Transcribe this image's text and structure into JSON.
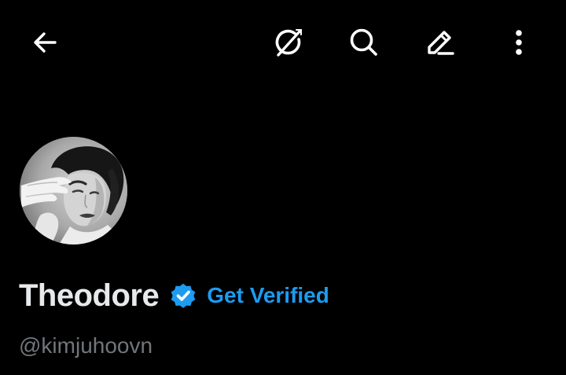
{
  "header": {
    "back_icon": "arrow-left-icon",
    "grok_icon": "grok-icon",
    "search_icon": "search-icon",
    "edit_icon": "pencil-icon",
    "more_icon": "more-vertical-icon"
  },
  "profile": {
    "display_name": "Theodore",
    "verified_badge_icon": "verified-badge-icon",
    "get_verified_label": "Get Verified",
    "handle": "@kimjuhoovn"
  },
  "colors": {
    "background": "#000000",
    "primary_text": "#e7e9ea",
    "secondary_text": "#71767b",
    "accent": "#1d9bf0"
  }
}
